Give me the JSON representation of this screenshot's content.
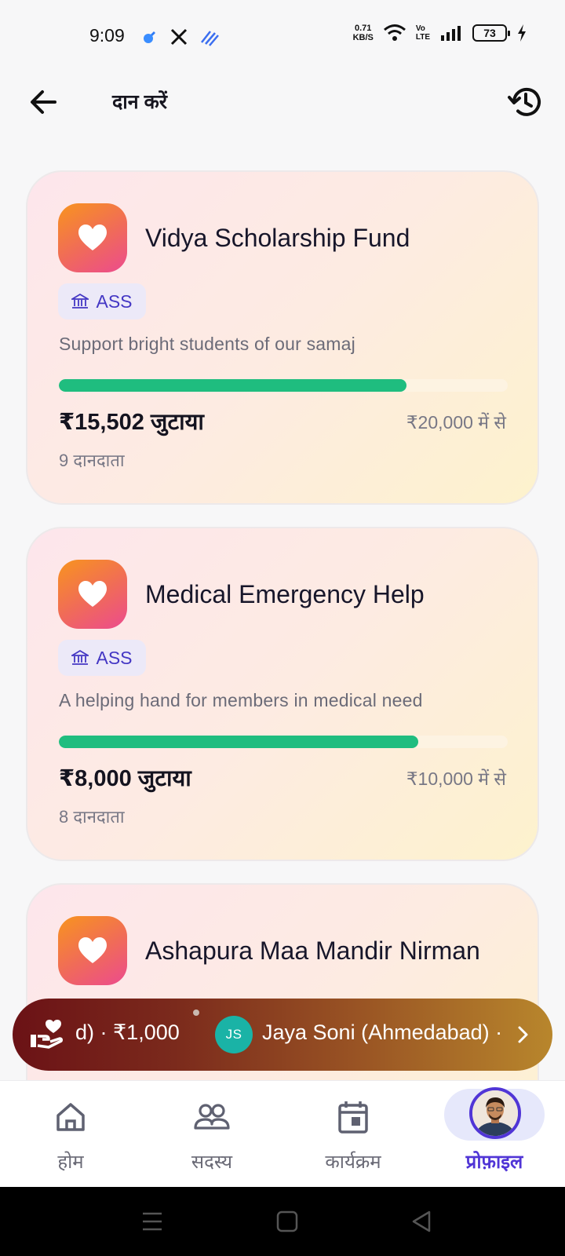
{
  "status_bar": {
    "time": "9:09",
    "speed_value": "0.71",
    "speed_unit": "KB/S",
    "volte_top": "Vo",
    "volte_bottom": "LTE",
    "battery": "73"
  },
  "header": {
    "title": "दान करें",
    "back_icon": "arrow-left-icon",
    "history_icon": "history-icon"
  },
  "campaigns": [
    {
      "title": "Vidya Scholarship Fund",
      "org": "ASS",
      "description": "Support bright students of our samaj",
      "raised": "₹15,502 जुटाया",
      "goal": "₹20,000 में से",
      "donors": "9 दानदाता",
      "progress": 0.775
    },
    {
      "title": "Medical Emergency Help",
      "org": "ASS",
      "description": "A helping hand for members in medical need",
      "raised": "₹8,000 जुटाया",
      "goal": "₹10,000 में से",
      "donors": "8 दानदाता",
      "progress": 0.8
    },
    {
      "title": "Ashapura Maa Mandir Nirman",
      "org": "",
      "description": "",
      "raised": "",
      "goal": "",
      "donors": "",
      "progress": 0
    }
  ],
  "ticker": {
    "text1": "d) · ₹1,000",
    "avatar_initials": "JS",
    "text2": "Jaya Soni (Ahmedabad) ·"
  },
  "bottom_nav": {
    "items": [
      {
        "label": "होम",
        "icon": "home-icon"
      },
      {
        "label": "सदस्य",
        "icon": "members-icon"
      },
      {
        "label": "कार्यक्रम",
        "icon": "calendar-icon"
      },
      {
        "label": "प्रोफ़ाइल",
        "icon": "profile-avatar"
      }
    ],
    "active_index": 3
  },
  "colors": {
    "accent": "#5035d6",
    "progress": "#1fbd7f",
    "badge_text": "#4437c4"
  }
}
